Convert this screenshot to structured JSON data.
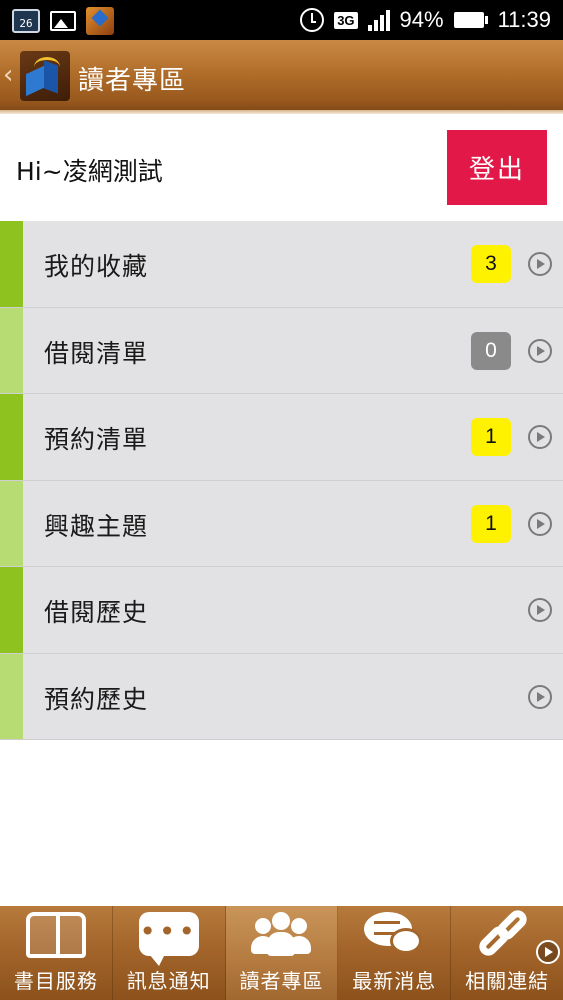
{
  "status_bar": {
    "date_icon_text": "26",
    "network": "3G",
    "battery": "94%",
    "time": "11:39"
  },
  "header": {
    "title": "讀者專區",
    "back_icon": "chevron-left-icon"
  },
  "user": {
    "greeting": "Hi~凌網測試",
    "logout_label": "登出"
  },
  "menu": {
    "items": [
      {
        "label": "我的收藏",
        "badge": "3",
        "badge_style": "yellow"
      },
      {
        "label": "借閱清單",
        "badge": "0",
        "badge_style": "gray"
      },
      {
        "label": "預約清單",
        "badge": "1",
        "badge_style": "yellow"
      },
      {
        "label": "興趣主題",
        "badge": "1",
        "badge_style": "yellow"
      },
      {
        "label": "借閱歷史",
        "badge": "",
        "badge_style": ""
      },
      {
        "label": "預約歷史",
        "badge": "",
        "badge_style": ""
      }
    ]
  },
  "bottom_nav": {
    "items": [
      {
        "label": "書目服務",
        "icon": "book-icon"
      },
      {
        "label": "訊息通知",
        "icon": "chat-icon"
      },
      {
        "label": "讀者專區",
        "icon": "people-icon",
        "active": true
      },
      {
        "label": "最新消息",
        "icon": "news-icon"
      },
      {
        "label": "相關連結",
        "icon": "link-icon"
      }
    ]
  },
  "colors": {
    "accent_green_dark": "#8dc21f",
    "accent_green_light": "#b8dc74",
    "logout_red": "#e21848",
    "badge_yellow": "#fff200",
    "badge_gray": "#8a8a8a",
    "header_brown": "#b06d2a"
  }
}
